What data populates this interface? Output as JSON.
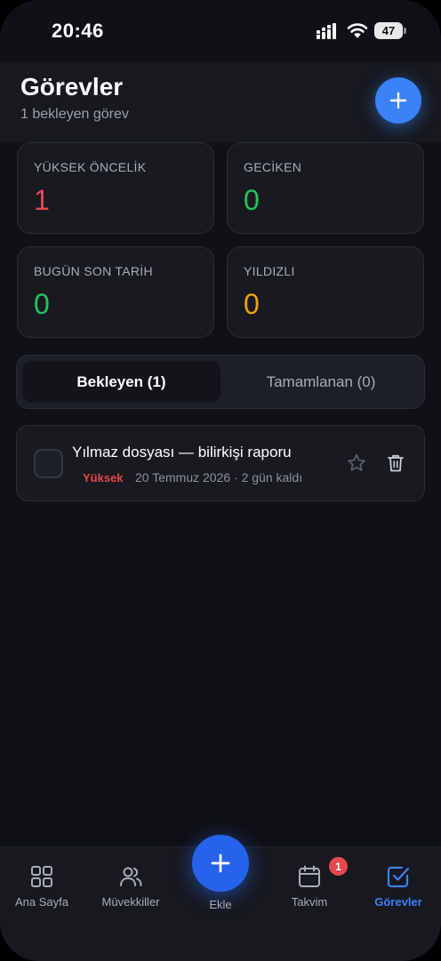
{
  "status_bar": {
    "time": "20:46",
    "battery": "47"
  },
  "header": {
    "title": "Görevler",
    "subtitle": "1 bekleyen görev"
  },
  "stats": [
    {
      "label": "YÜKSEK ÖNCELİK",
      "value": "1",
      "color": "#e5484d"
    },
    {
      "label": "GECİKEN",
      "value": "0",
      "color": "#22c55e"
    },
    {
      "label": "BUGÜN SON TARİH",
      "value": "0",
      "color": "#22c55e"
    },
    {
      "label": "YILDIZLI",
      "value": "0",
      "color": "#f59e0b"
    }
  ],
  "segments": {
    "active": "Bekleyen (1)",
    "inactive": "Tamamlanan (0)"
  },
  "tasks": [
    {
      "title": "Yılmaz dosyası — bilirkişi raporu",
      "priority": "Yüksek",
      "meta": "20 Temmuz 2026 · 2 gün kaldı"
    }
  ],
  "tab_bar": {
    "items": [
      {
        "label": "Ana Sayfa",
        "icon": "grid-icon"
      },
      {
        "label": "Müvekkiller",
        "icon": "users-icon"
      },
      {
        "label": "Ekle",
        "icon": "plus-icon"
      },
      {
        "label": "Takvim",
        "icon": "calendar-icon",
        "badge": "1"
      },
      {
        "label": "Görevler",
        "icon": "check-square-icon"
      }
    ]
  },
  "colors": {
    "accent": "#3b82f6",
    "background": "#101116",
    "danger": "#e5484d",
    "success": "#22c55e",
    "warning": "#f59e0b"
  }
}
